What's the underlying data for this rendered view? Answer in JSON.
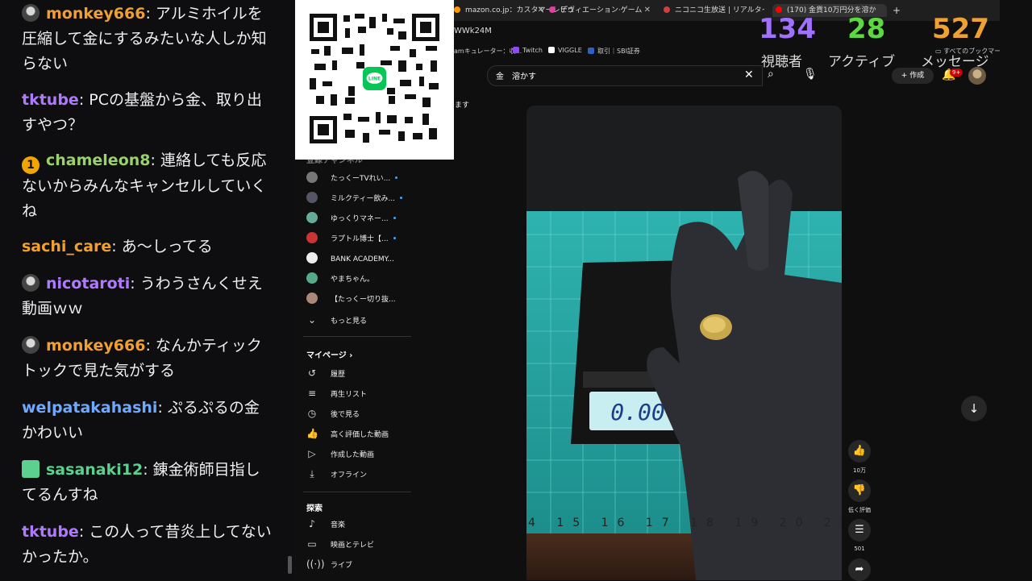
{
  "chat": {
    "messages": [
      {
        "user": "monkey666",
        "color": "#f0a030",
        "badge": "avatar",
        "text": "アルミホイルを圧縮して金にするみたいな人しか知らない"
      },
      {
        "user": "tktube",
        "color": "#b07aff",
        "badge": "",
        "text": "PCの基盤から金、取り出すやつ？"
      },
      {
        "user": "chameleon8",
        "color": "#9ad16a",
        "badge": "gold",
        "badge_text": "1",
        "text": "連絡しても反応ないからみんなキャンセルしていくね"
      },
      {
        "user": "sachi_care",
        "color": "#f0a030",
        "badge": "",
        "text": "あ〜しってる"
      },
      {
        "user": "nicotaroti",
        "color": "#b07aff",
        "badge": "avatar",
        "text": "うわうさんくせえ動画ｗｗ"
      },
      {
        "user": "monkey666",
        "color": "#f0a030",
        "badge": "avatar",
        "text": "なんかティックトックで見た気がする"
      },
      {
        "user": "welpatakahashi",
        "color": "#6fa8ff",
        "badge": "",
        "text": "ぷるぷるの金かわいい"
      },
      {
        "user": "sasanaki12",
        "color": "#5cd18f",
        "badge": "gift",
        "text": "錬金術師目指してるんすね"
      },
      {
        "user": "tktube",
        "color": "#b07aff",
        "badge": "",
        "text": "この人って昔炎上してないかったか。"
      }
    ]
  },
  "qr": {
    "logo_text": "LINE"
  },
  "browser": {
    "tabs": [
      {
        "label": "mazon.co.jp：カスタマーレビュ",
        "icon_color": "#ff9900"
      },
      {
        "label": "デヴィエーション·ゲーム",
        "icon_color": "#e040a0"
      },
      {
        "label": "ニコニコ生放送 | リアルタイムラン",
        "icon_color": "#d04040"
      },
      {
        "label": "(170) 金貨10万円分を溶か",
        "icon_color": "#ff0000"
      }
    ],
    "new_tab": "+",
    "url": "WWk24M",
    "bookmarks": [
      {
        "label": "amキュレーター：収...",
        "icon_color": "#555"
      },
      {
        "label": "Twitch",
        "icon_color": "#9146ff"
      },
      {
        "label": "VIGGLE",
        "icon_color": "#fff"
      },
      {
        "label": "取引｜SBI証券",
        "icon_color": "#3060c0"
      }
    ],
    "all_bookmarks": "すべてのブックマーク"
  },
  "stats": {
    "viewers": {
      "value": "134",
      "label": "視聴者",
      "color": "#a070ff"
    },
    "active": {
      "value": "28",
      "label": "アクティブ",
      "color": "#5cd840"
    },
    "messages": {
      "value": "527",
      "label": "メッセージ",
      "color": "#f0a030"
    }
  },
  "youtube": {
    "search_query": "金　溶かす",
    "create_label": "作成",
    "notif_count": "9+",
    "side_top_fragment": "ます",
    "subs_header": "登録チャンネル",
    "subscriptions": [
      {
        "label": "たっくーTVれい...",
        "icon_color": "#777"
      },
      {
        "label": "ミルクティー飲み...",
        "icon_color": "#556"
      },
      {
        "label": "ゆっくりマネー...",
        "icon_color": "#6a9"
      },
      {
        "label": "ラプトル博士【...",
        "icon_color": "#c33"
      },
      {
        "label": "BANK ACADEMY...",
        "icon_color": "#eee"
      },
      {
        "label": "やまちゃん。",
        "icon_color": "#5a8"
      },
      {
        "label": "【たっくー切り抜...",
        "icon_color": "#a87"
      }
    ],
    "more_label": "もっと見る",
    "mypage_label": "マイページ",
    "mypage_items": [
      {
        "label": "履歴",
        "icon": "history-icon",
        "glyph": "↺"
      },
      {
        "label": "再生リスト",
        "icon": "playlist-icon",
        "glyph": "≡"
      },
      {
        "label": "後で見る",
        "icon": "clock-icon",
        "glyph": "◷"
      },
      {
        "label": "高く評価した動画",
        "icon": "thumbs-up-icon",
        "glyph": "👍"
      },
      {
        "label": "作成した動画",
        "icon": "video-icon",
        "glyph": "▷"
      },
      {
        "label": "オフライン",
        "icon": "download-icon",
        "glyph": "⤓"
      }
    ],
    "explore_label": "探索",
    "explore_items": [
      {
        "label": "音楽",
        "icon": "music-icon",
        "glyph": "♪"
      },
      {
        "label": "映画とテレビ",
        "icon": "film-icon",
        "glyph": "▭"
      },
      {
        "label": "ライブ",
        "icon": "live-icon",
        "glyph": "((·))"
      }
    ],
    "likes": "10万",
    "dislike_label": "低く評価",
    "comments": "501",
    "scale_display": "0.00",
    "ruler": "4 15 16 17 18 19 20 21 22 23"
  }
}
